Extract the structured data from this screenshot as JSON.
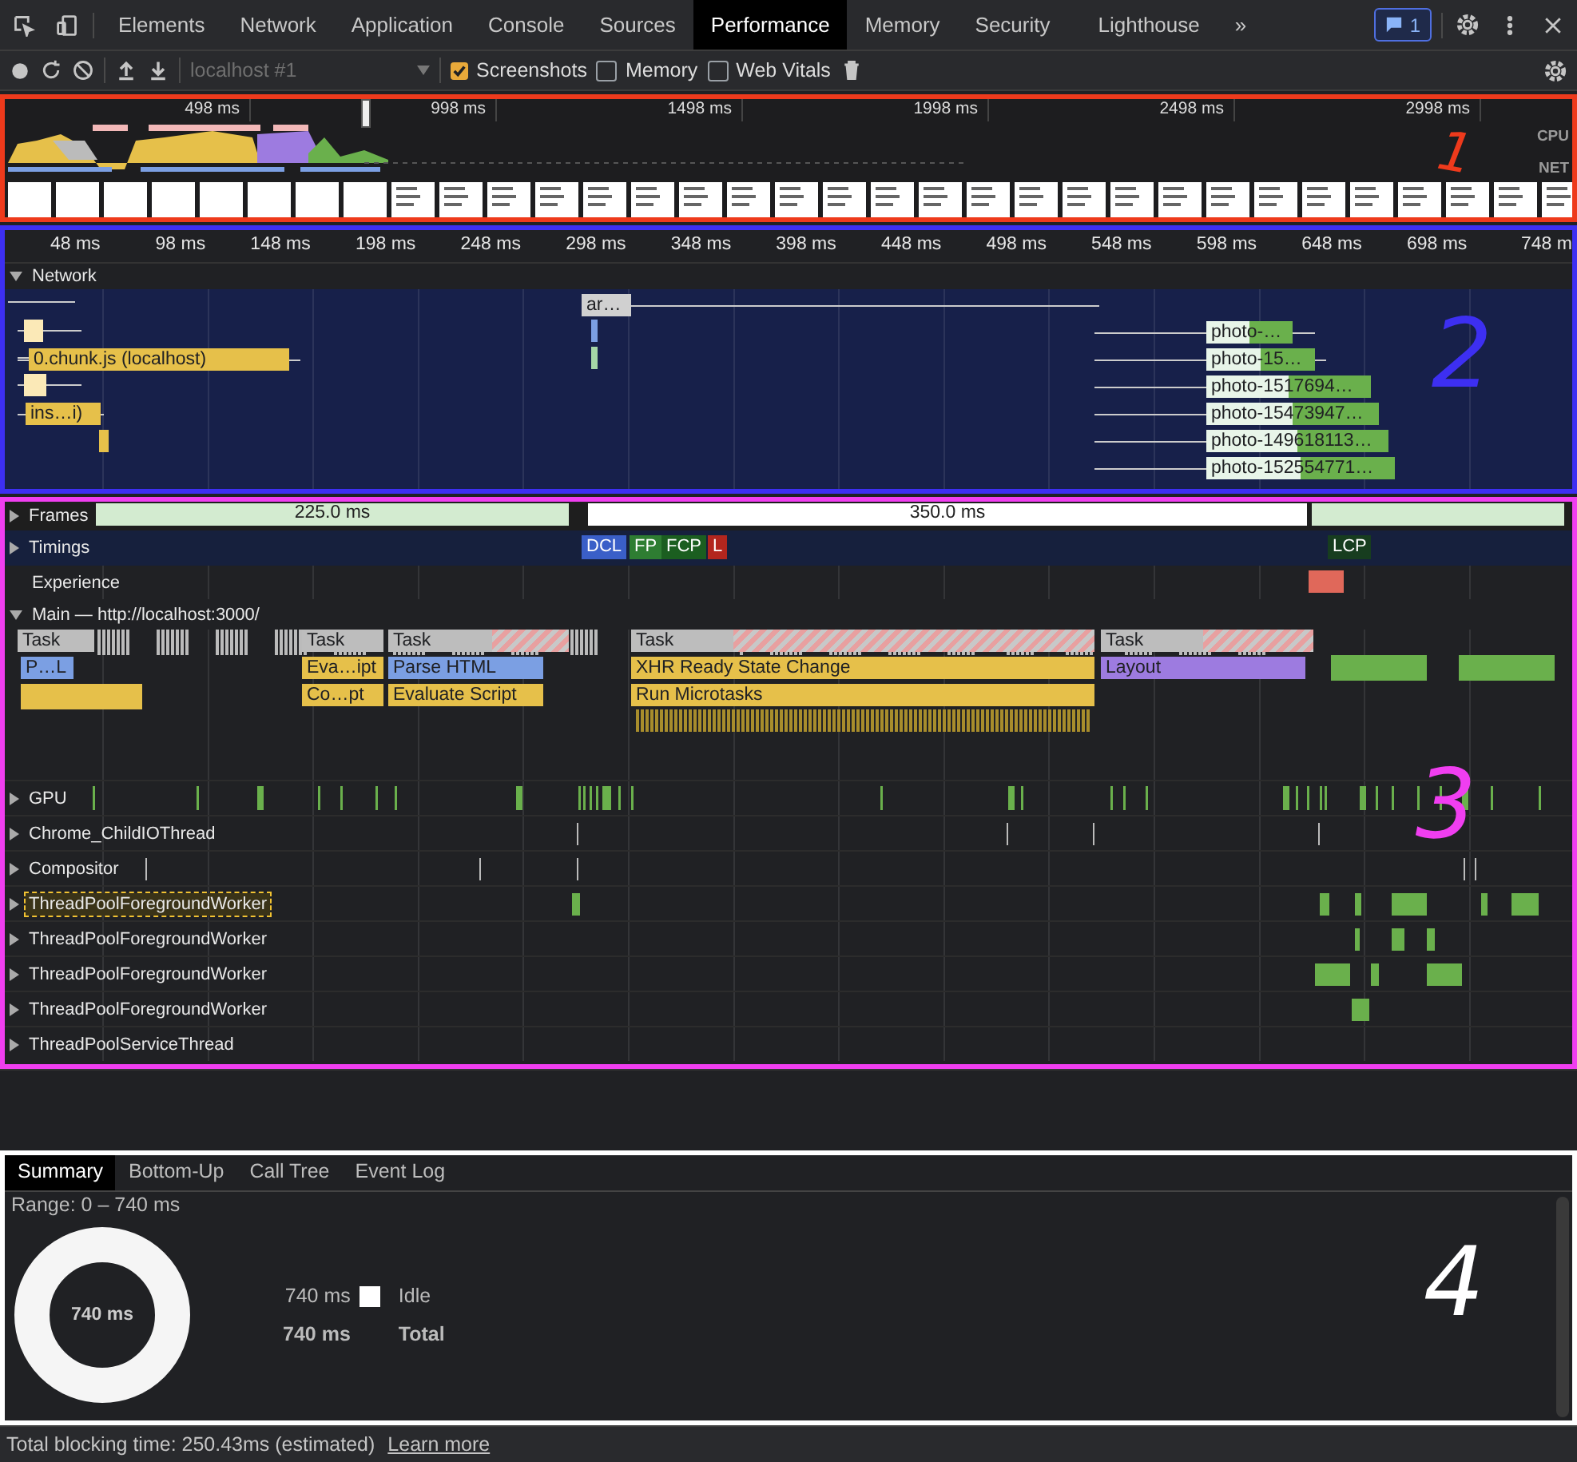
{
  "devtools_tabs": [
    {
      "label": "Elements",
      "selected": false
    },
    {
      "label": "Network",
      "selected": false
    },
    {
      "label": "Application",
      "selected": false
    },
    {
      "label": "Console",
      "selected": false
    },
    {
      "label": "Sources",
      "selected": false
    },
    {
      "label": "Performance",
      "selected": true
    },
    {
      "label": "Memory",
      "selected": false
    },
    {
      "label": "Security",
      "selected": false
    },
    {
      "label": "Lighthouse",
      "selected": false
    }
  ],
  "more_tabs": "»",
  "issues_count": "1",
  "toolbar": {
    "profile": "localhost #1",
    "options": [
      {
        "label": "Screenshots",
        "checked": true
      },
      {
        "label": "Memory",
        "checked": false
      },
      {
        "label": "Web Vitals",
        "checked": false
      }
    ]
  },
  "overview": {
    "ticks": [
      "498 ms",
      "998 ms",
      "1498 ms",
      "1998 ms",
      "2498 ms",
      "2998 ms"
    ],
    "lanes": [
      "CPU",
      "NET"
    ]
  },
  "ruler": [
    "48 ms",
    "98 ms",
    "148 ms",
    "198 ms",
    "248 ms",
    "298 ms",
    "348 ms",
    "398 ms",
    "448 ms",
    "498 ms",
    "548 ms",
    "598 ms",
    "648 ms",
    "698 ms",
    "748 m"
  ],
  "network": {
    "title": "Network",
    "expanded": true,
    "requests": [
      {
        "label": "ar…"
      },
      {
        "label": "0.chunk.js (localhost)"
      },
      {
        "label": "ins…i)"
      },
      {
        "label": "photo-…"
      },
      {
        "label": "photo-15…"
      },
      {
        "label": "photo-1517694…"
      },
      {
        "label": "photo-15473947…"
      },
      {
        "label": "photo-149618113…"
      },
      {
        "label": "photo-152554771…"
      }
    ]
  },
  "tracks": [
    {
      "kind": "frames",
      "title": "Frames",
      "expanded": false,
      "frames": [
        "225.0 ms",
        "350.0 ms"
      ]
    },
    {
      "kind": "timings",
      "title": "Timings",
      "expanded": false,
      "markers": [
        {
          "label": "DCL",
          "color": "#3a5fc8"
        },
        {
          "label": "FP",
          "color": "#2e7d32"
        },
        {
          "label": "FCP",
          "color": "#1b5e20"
        },
        {
          "label": "L",
          "color": "#b3261e"
        },
        {
          "label": "LCP",
          "color": "#173d1f"
        }
      ]
    },
    {
      "kind": "experience",
      "title": "Experience"
    },
    {
      "kind": "main",
      "title": "Main — http://localhost:3000/",
      "expanded": true,
      "entries": [
        {
          "label": "Task"
        },
        {
          "label": "Task"
        },
        {
          "label": "Task"
        },
        {
          "label": "Task"
        },
        {
          "label": "Task"
        },
        {
          "label": "P…L"
        },
        {
          "label": "Eva…ipt"
        },
        {
          "label": "Parse HTML"
        },
        {
          "label": "XHR Ready State Change"
        },
        {
          "label": "Layout"
        },
        {
          "label": "Co…pt"
        },
        {
          "label": "Evaluate Script"
        },
        {
          "label": "Run Microtasks"
        }
      ]
    },
    {
      "kind": "thread",
      "title": "GPU",
      "expanded": false,
      "selected": false
    },
    {
      "kind": "thread",
      "title": "Chrome_ChildIOThread",
      "expanded": false,
      "selected": false
    },
    {
      "kind": "thread",
      "title": "Compositor",
      "expanded": false,
      "selected": false
    },
    {
      "kind": "thread",
      "title": "ThreadPoolForegroundWorker",
      "expanded": false,
      "selected": true
    },
    {
      "kind": "thread",
      "title": "ThreadPoolForegroundWorker",
      "expanded": false,
      "selected": false
    },
    {
      "kind": "thread",
      "title": "ThreadPoolForegroundWorker",
      "expanded": false,
      "selected": false
    },
    {
      "kind": "thread",
      "title": "ThreadPoolForegroundWorker",
      "expanded": false,
      "selected": false
    },
    {
      "kind": "thread",
      "title": "ThreadPoolServiceThread",
      "expanded": false,
      "selected": false
    }
  ],
  "summary": {
    "tabs": [
      {
        "label": "Summary",
        "selected": true
      },
      {
        "label": "Bottom-Up",
        "selected": false
      },
      {
        "label": "Call Tree",
        "selected": false
      },
      {
        "label": "Event Log",
        "selected": false
      }
    ],
    "range": "Range: 0 – 740 ms",
    "center": "740 ms",
    "rows": [
      {
        "kind": "item",
        "value": "740 ms",
        "label": "Idle"
      },
      {
        "kind": "total",
        "value": "740 ms",
        "label": "Total"
      }
    ]
  },
  "footer": {
    "text": "Total blocking time: 250.43ms (estimated)",
    "link": "Learn more"
  },
  "annotations": [
    {
      "label": "1",
      "color": "#ee3a1c"
    },
    {
      "label": "2",
      "color": "#3d2ff2"
    },
    {
      "label": "3",
      "color": "#f03ef0"
    },
    {
      "label": "4",
      "color": "#ffffff"
    }
  ]
}
